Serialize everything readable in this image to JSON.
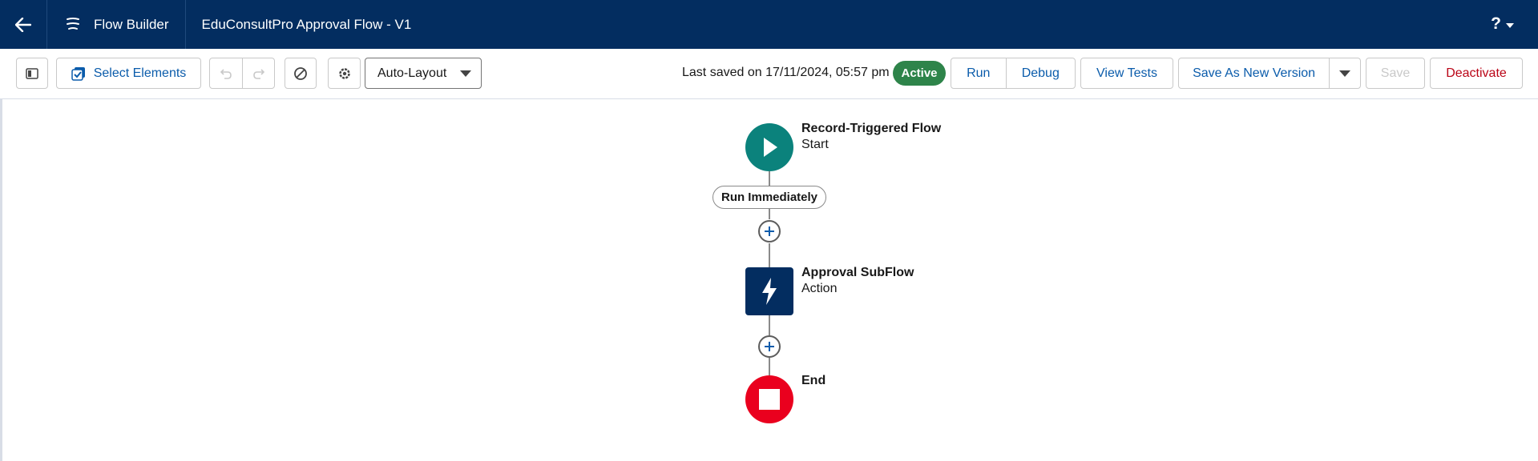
{
  "header": {
    "back_icon": "arrow-left-icon",
    "app_icon": "flow-icon",
    "app_name": "Flow Builder",
    "flow_title": "EduConsultPro Approval Flow - V1",
    "help_label": "?",
    "colors": {
      "background": "#032d60",
      "text": "#ffffff"
    }
  },
  "toolbar": {
    "toggle_panel_icon": "panel-toggle-icon",
    "select_elements_label": "Select Elements",
    "select_elements_icon": "checkbox-icon",
    "undo_icon": "undo-icon",
    "redo_icon": "redo-icon",
    "no_entry_icon": "ban-icon",
    "settings_icon": "gear-icon",
    "layout_select_value": "Auto-Layout",
    "last_saved_text": "Last saved on 17/11/2024, 05:57 pm",
    "status_badge": "Active",
    "run_label": "Run",
    "debug_label": "Debug",
    "view_tests_label": "View Tests",
    "save_as_new_version_label": "Save As New Version",
    "save_label": "Save",
    "deactivate_label": "Deactivate",
    "colors": {
      "link": "#0b5cab",
      "active_badge": "#2e844a",
      "deactivate": "#ba0517",
      "disabled": "#c9c9c9"
    }
  },
  "canvas": {
    "start_node": {
      "title": "Record-Triggered Flow",
      "subtitle": "Start",
      "icon": "play-icon",
      "color": "#0b827c"
    },
    "path_label": "Run Immediately",
    "action_node": {
      "title": "Approval SubFlow",
      "subtitle": "Action",
      "icon": "lightning-icon",
      "color": "#032d60"
    },
    "end_node": {
      "title": "End",
      "icon": "stop-icon",
      "color": "#ea001e"
    },
    "add_icon": "plus-icon"
  }
}
